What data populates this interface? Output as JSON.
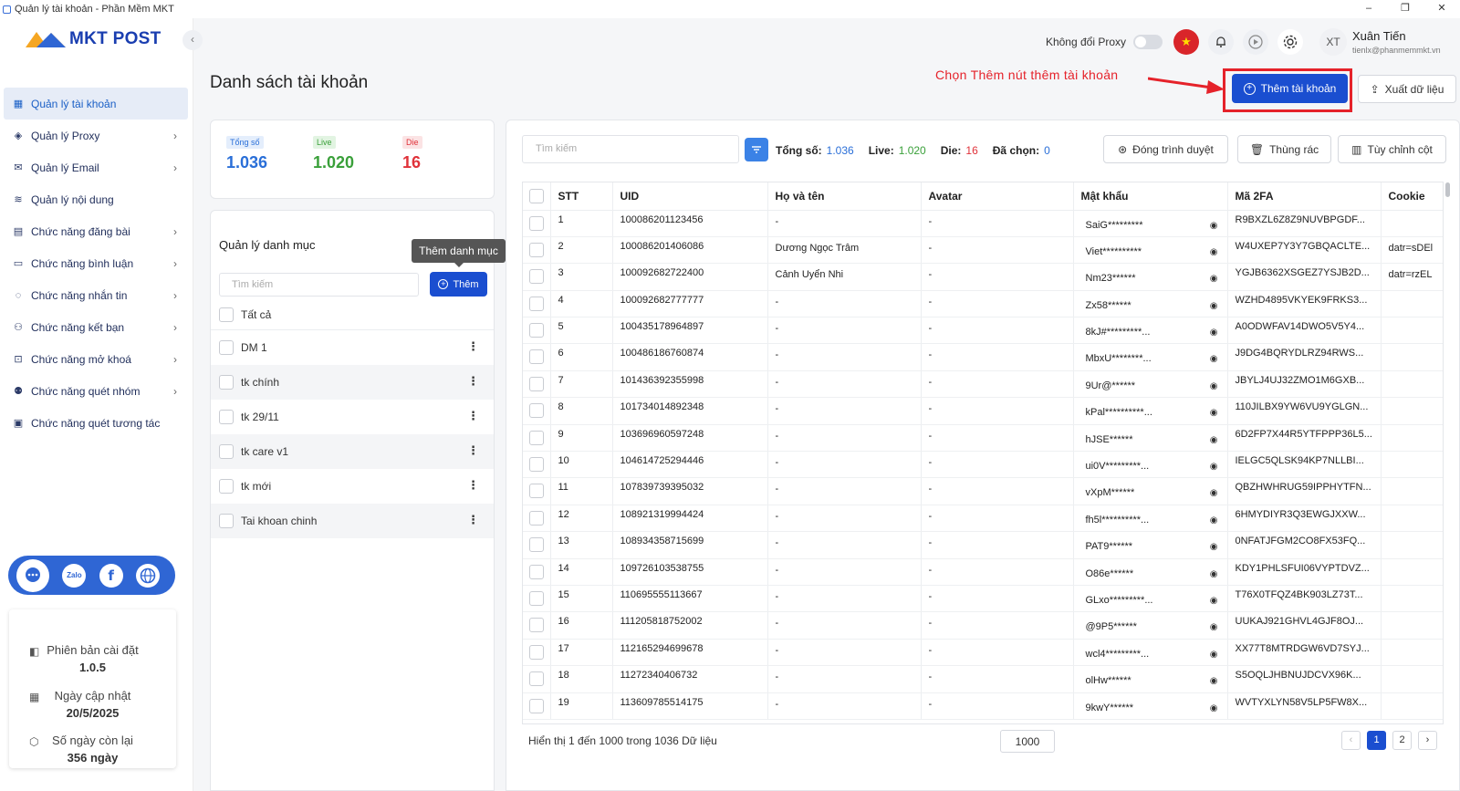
{
  "window": {
    "title": "Quản lý tài khoản - Phần Mềm MKT",
    "controls": [
      "–",
      "❐",
      "✕"
    ]
  },
  "logo": {
    "text": "MKT POST"
  },
  "sidebar": {
    "items": [
      {
        "label": "Quản lý tài khoản",
        "icon": "grid-icon",
        "glyph": "▦",
        "active": true,
        "chevron": false
      },
      {
        "label": "Quản lý Proxy",
        "icon": "layers-icon",
        "glyph": "◈",
        "chevron": true
      },
      {
        "label": "Quản lý Email",
        "icon": "mail-icon",
        "glyph": "✉",
        "chevron": true
      },
      {
        "label": "Quản lý nội dung",
        "icon": "content-icon",
        "glyph": "≋",
        "chevron": false
      },
      {
        "label": "Chức năng đăng bài",
        "icon": "post-icon",
        "glyph": "▤",
        "chevron": true
      },
      {
        "label": "Chức năng bình luận",
        "icon": "comment-icon",
        "glyph": "▭",
        "chevron": true
      },
      {
        "label": "Chức năng nhắn tin",
        "icon": "message-icon",
        "glyph": "◌",
        "chevron": true
      },
      {
        "label": "Chức năng kết bạn",
        "icon": "add-friend-icon",
        "glyph": "⚇",
        "chevron": true
      },
      {
        "label": "Chức năng mở khoá",
        "icon": "unlock-icon",
        "glyph": "⊡",
        "chevron": true
      },
      {
        "label": "Chức năng quét nhóm",
        "icon": "group-icon",
        "glyph": "⚉",
        "chevron": true
      },
      {
        "label": "Chức năng quét tương tác",
        "icon": "interaction-icon",
        "glyph": "▣",
        "chevron": false
      }
    ],
    "social": [
      "support-chat",
      "zalo",
      "facebook",
      "website"
    ],
    "social_text": {
      "zalo": "Zalo",
      "facebook": "f"
    }
  },
  "version": {
    "installed_label": "Phiên bản cài đặt",
    "installed_value": "1.0.5",
    "updated_label": "Ngày cập nhật",
    "updated_value": "20/5/2025",
    "remaining_label": "Số ngày còn lại",
    "remaining_value": "356 ngày"
  },
  "header": {
    "proxy_label": "Không đổi Proxy",
    "avatar_initials": "XT",
    "user_name": "Xuân Tiến",
    "user_email": "tienlx@phanmemmkt.vn"
  },
  "page": {
    "title": "Danh sách tài khoản",
    "annotation": "Chọn Thêm nút thêm tài khoản",
    "add_account_label": "Thêm tài khoản",
    "export_label": "Xuất dữ liệu"
  },
  "stats": {
    "total_label": "Tổng số",
    "total_value": "1.036",
    "live_label": "Live",
    "live_value": "1.020",
    "die_label": "Die",
    "die_value": "16",
    "colors": {
      "total": "#2a6fd8",
      "live": "#3aa03a",
      "die": "#e0323a"
    }
  },
  "categories": {
    "title": "Quản lý danh mục",
    "tooltip": "Thêm danh mục",
    "search_placeholder": "Tìm kiếm",
    "add_label": "Thêm",
    "all_label": "Tất cả",
    "items": [
      "DM 1",
      "tk chính",
      "tk 29/11",
      "tk care v1",
      "tk mới",
      "Tai khoan chinh"
    ]
  },
  "table": {
    "search_placeholder": "Tìm kiếm",
    "total_label": "Tổng số:",
    "total_value": "1.036",
    "live_label": "Live:",
    "live_value": "1.020",
    "die_label": "Die:",
    "die_value": "16",
    "selected_label": "Đã chọn:",
    "selected_value": "0",
    "close_browser_label": "Đóng trình duyệt",
    "trash_label": "Thùng rác",
    "columns_label": "Tùy chỉnh cột",
    "headers": [
      "STT",
      "UID",
      "Họ và tên",
      "Avatar",
      "Mật khẩu",
      "Mã 2FA",
      "Cookie"
    ],
    "rows": [
      [
        "1",
        "100086201123456",
        "-",
        "-",
        "SaiG*********",
        "R9BXZL6Z8Z9NUVBPGDF...",
        ""
      ],
      [
        "2",
        "100086201406086",
        "Dương Ngọc Trâm",
        "-",
        "Viet**********",
        "W4UXEP7Y3Y7GBQACLTE...",
        "datr=sDEl"
      ],
      [
        "3",
        "100092682722400",
        "Cảnh Uyển Nhi",
        "-",
        "Nm23******",
        "YGJB6362XSGEZ7YSJB2D...",
        "datr=rzEL"
      ],
      [
        "4",
        "100092682777777",
        "-",
        "-",
        "Zx58******",
        "WZHD4895VKYEK9FRKS3...",
        ""
      ],
      [
        "5",
        "100435178964897",
        "-",
        "-",
        "8kJ#*********...",
        "A0ODWFAV14DWO5V5Y4...",
        ""
      ],
      [
        "6",
        "100486186760874",
        "-",
        "-",
        "MbxU********...",
        "J9DG4BQRYDLRZ94RWS...",
        ""
      ],
      [
        "7",
        "101436392355998",
        "-",
        "-",
        "9Ur@******",
        "JBYLJ4UJ32ZMO1M6GXB...",
        ""
      ],
      [
        "8",
        "101734014892348",
        "-",
        "-",
        "kPal**********...",
        "110JILBX9YW6VU9YGLGN...",
        ""
      ],
      [
        "9",
        "103696960597248",
        "-",
        "-",
        "hJSE******",
        "6D2FP7X44R5YTFPPP36L5...",
        ""
      ],
      [
        "10",
        "104614725294446",
        "-",
        "-",
        "ui0V*********...",
        "IELGC5QLSK94KP7NLLBI...",
        ""
      ],
      [
        "11",
        "107839739395032",
        "-",
        "-",
        "vXpM******",
        "QBZHWHRUG59IPPHYTFN...",
        ""
      ],
      [
        "12",
        "108921319994424",
        "-",
        "-",
        "fh5l**********...",
        "6HMYDIYR3Q3EWGJXXW...",
        ""
      ],
      [
        "13",
        "108934358715699",
        "-",
        "-",
        "PAT9******",
        "0NFATJFGM2CO8FX53FQ...",
        ""
      ],
      [
        "14",
        "109726103538755",
        "-",
        "-",
        "O86e******",
        "KDY1PHLSFUI06VYPTDVZ...",
        ""
      ],
      [
        "15",
        "110695555113667",
        "-",
        "-",
        "GLxo*********...",
        "T76X0TFQZ4BK903LZ73T...",
        ""
      ],
      [
        "16",
        "111205818752002",
        "-",
        "-",
        "@9P5******",
        "UUKAJ921GHVL4GJF8OJ...",
        ""
      ],
      [
        "17",
        "112165294699678",
        "-",
        "-",
        "wcl4*********...",
        "XX77T8MTRDGW6VD7SYJ...",
        ""
      ],
      [
        "18",
        "11272340406732",
        "-",
        "-",
        "olHw******",
        "S5OQLJHBNUJDCVX96K...",
        ""
      ],
      [
        "19",
        "113609785514175",
        "-",
        "-",
        "9kwY******",
        "WVTYXLYN58V5LP5FW8X...",
        ""
      ]
    ],
    "footer_text": "Hiển thị 1 đến 1000 trong 1036 Dữ liệu",
    "page_size": "1000",
    "pages": [
      "‹",
      "1",
      "2",
      "›"
    ],
    "current_page": "1"
  }
}
